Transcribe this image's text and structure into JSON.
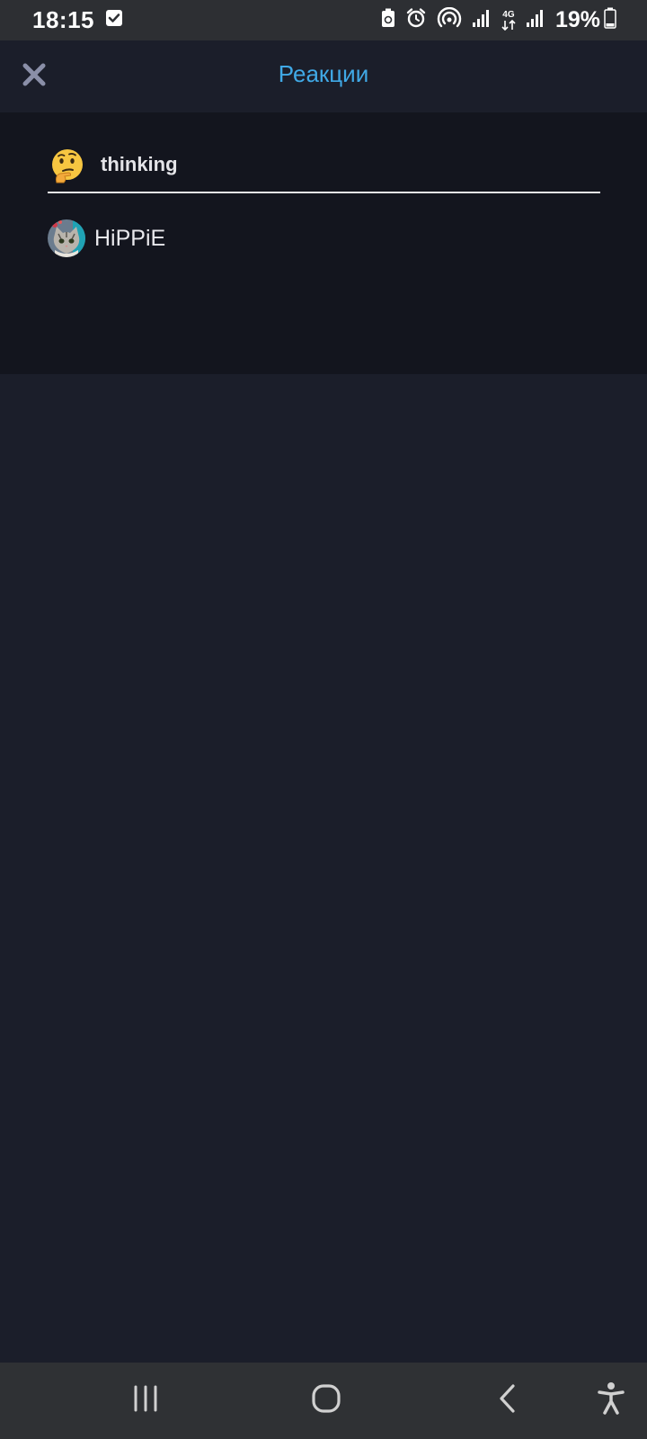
{
  "status_bar": {
    "time": "18:15",
    "network_label_top": "4G",
    "battery_percent": "19%"
  },
  "header": {
    "title": "Реакции",
    "close_icon": "close-icon"
  },
  "reactions": {
    "active_tab": {
      "emoji_icon": "thinking-face-icon",
      "label": "thinking"
    },
    "users": [
      {
        "name": "HiPPiE",
        "avatar_icon": "cat-avatar"
      }
    ]
  },
  "colors": {
    "accent": "#40a9e6",
    "background": "#1b1e2a",
    "panel": "#13151e",
    "status_bar": "#2d2f33"
  }
}
